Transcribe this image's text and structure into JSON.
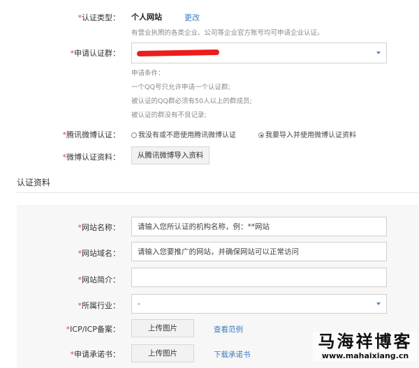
{
  "cert_type": {
    "label": "*认证类型：",
    "value": "个人网站",
    "change_link": "更改",
    "hint": "有营业执照的各类企业、公司等企业官方账号均可申请企业认证。"
  },
  "apply_group": {
    "label": "*申请认证群：",
    "selected": "",
    "conditions": [
      "申请条件：",
      "一个QQ号只允许申请一个认证群;",
      "被认证的QQ群必须有50人以上的群成员;",
      "被认证的群没有不良记录;"
    ]
  },
  "weibo_cert": {
    "label": "*腾讯微博认证：",
    "options": [
      "我没有或不愿使用腾讯微博认证",
      "我要导入并使用微博认证资料"
    ],
    "selected_index": 1
  },
  "weibo_data": {
    "label": "*微博认证资料：",
    "button": "从腾讯微博导入资料"
  },
  "section_title": "认证资料",
  "site_name": {
    "label": "*网站名称：",
    "placeholder": "请输入您所认证的机构名称，例：**网站"
  },
  "site_domain": {
    "label": "*网站域名：",
    "placeholder": "请输入您要推广的网站，并确保网站可以正常访问"
  },
  "site_intro": {
    "label": "*网站简介：",
    "value": ""
  },
  "industry": {
    "label": "*所属行业：",
    "value": "-"
  },
  "icp": {
    "label": "*ICP/ICP备案：",
    "button": "上传图片",
    "link": "查看范例"
  },
  "commitment": {
    "label": "*申请承诺书：",
    "button": "上传图片",
    "link": "下载承诺书"
  },
  "watermark": {
    "name": "马海祥博客",
    "url": "www.mahaixiang.cn"
  },
  "colors": {
    "required": "#e04040",
    "link": "#3b7cc4",
    "redaction": "#ee1c1c"
  }
}
